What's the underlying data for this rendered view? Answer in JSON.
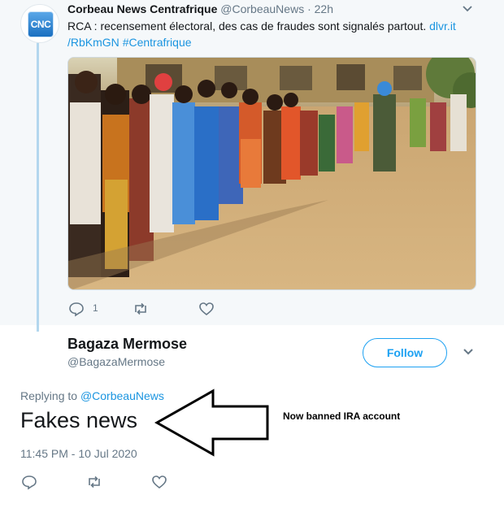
{
  "original_tweet": {
    "author_name": "Corbeau News Centrafrique",
    "handle": "@CorbeauNews",
    "separator": "·",
    "time": "22h",
    "avatar_text": "CNC",
    "text": "RCA : recensement électoral, des cas de fraudes sont signalés partout.",
    "link_part1": "dlvr.it",
    "link_part2": "/RbKmGN",
    "hashtag": "#Centrafrique",
    "reply_count": "1",
    "icons": [
      "reply-icon",
      "retweet-icon",
      "like-icon",
      "chevron-down-icon"
    ]
  },
  "reply_tweet": {
    "author_name": "Bagaza Mermose",
    "handle": "@BagazaMermose",
    "follow_label": "Follow",
    "replying_prefix": "Replying to",
    "replying_to": "@CorbeauNews",
    "text": "Fakes news",
    "timestamp": "11:45 PM - 10 Jul 2020",
    "icons": [
      "reply-icon",
      "retweet-icon",
      "like-icon",
      "chevron-down-icon"
    ]
  },
  "annotation": {
    "note": "Now banned IRA account",
    "icon": "left-arrow-icon"
  },
  "colors": {
    "link": "#1b95e0",
    "follow": "#1da1f2",
    "muted": "#657786",
    "thread_line": "#b3d7ee",
    "top_background": "#f5f8fa"
  }
}
